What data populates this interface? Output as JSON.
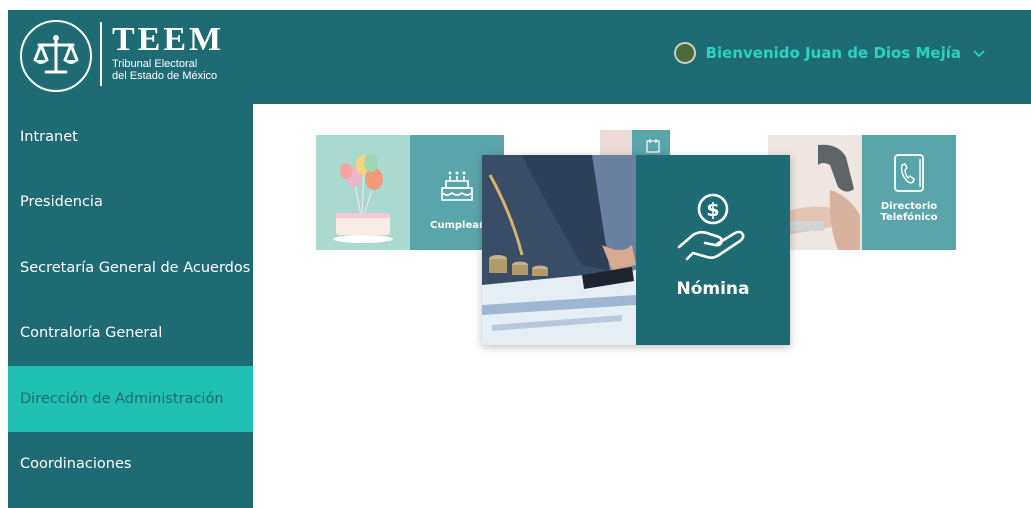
{
  "header": {
    "brand_title": "TEEM",
    "brand_line1": "Tribunal Electoral",
    "brand_line2": "del Estado de México",
    "welcome": "Bienvenido Juan de Dios Mejía",
    "accent": "#27d3c5",
    "bg": "#1f6b74"
  },
  "sidebar": {
    "items": [
      {
        "label": "Intranet"
      },
      {
        "label": "Presidencia"
      },
      {
        "label": "Secretaría General de Acuerdos"
      },
      {
        "label": "Contraloría General"
      },
      {
        "label": "Dirección de Administración",
        "active": true
      },
      {
        "label": "Coordinaciones"
      }
    ],
    "active_color": "#1fbfb3"
  },
  "cards": {
    "birthday": {
      "label": "Cumpleaños",
      "icon": "cake-icon"
    },
    "payroll": {
      "label": "Nómina",
      "icon": "hand-coin-icon"
    },
    "directory": {
      "line1": "Directorio",
      "line2": "Telefónico",
      "icon": "phone-book-icon"
    }
  }
}
